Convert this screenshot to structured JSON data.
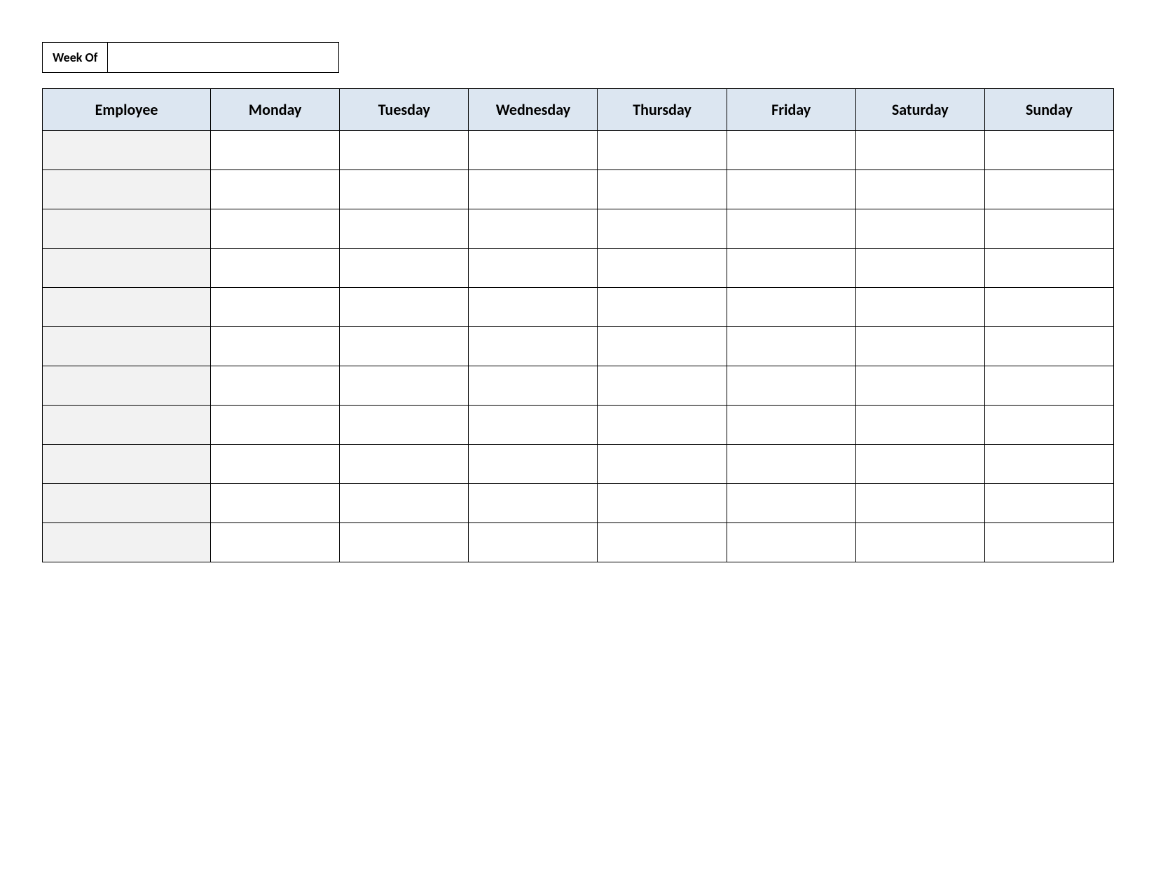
{
  "week_of_label": "Week Of",
  "week_of_value": "",
  "headers": {
    "employee": "Employee",
    "days": [
      "Monday",
      "Tuesday",
      "Wednesday",
      "Thursday",
      "Friday",
      "Saturday",
      "Sunday"
    ]
  },
  "rows": [
    {
      "employee": "",
      "cells": [
        "",
        "",
        "",
        "",
        "",
        "",
        ""
      ]
    },
    {
      "employee": "",
      "cells": [
        "",
        "",
        "",
        "",
        "",
        "",
        ""
      ]
    },
    {
      "employee": "",
      "cells": [
        "",
        "",
        "",
        "",
        "",
        "",
        ""
      ]
    },
    {
      "employee": "",
      "cells": [
        "",
        "",
        "",
        "",
        "",
        "",
        ""
      ]
    },
    {
      "employee": "",
      "cells": [
        "",
        "",
        "",
        "",
        "",
        "",
        ""
      ]
    },
    {
      "employee": "",
      "cells": [
        "",
        "",
        "",
        "",
        "",
        "",
        ""
      ]
    },
    {
      "employee": "",
      "cells": [
        "",
        "",
        "",
        "",
        "",
        "",
        ""
      ]
    },
    {
      "employee": "",
      "cells": [
        "",
        "",
        "",
        "",
        "",
        "",
        ""
      ]
    },
    {
      "employee": "",
      "cells": [
        "",
        "",
        "",
        "",
        "",
        "",
        ""
      ]
    },
    {
      "employee": "",
      "cells": [
        "",
        "",
        "",
        "",
        "",
        "",
        ""
      ]
    },
    {
      "employee": "",
      "cells": [
        "",
        "",
        "",
        "",
        "",
        "",
        ""
      ]
    }
  ]
}
